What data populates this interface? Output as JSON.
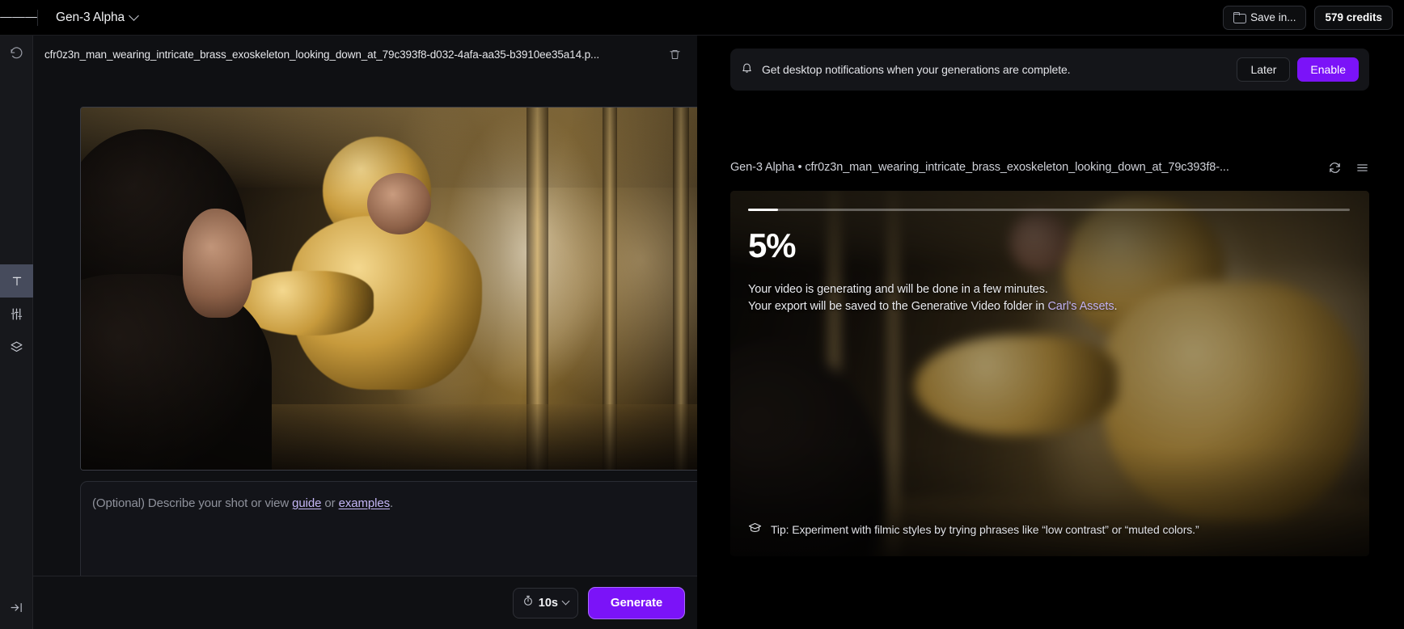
{
  "topbar": {
    "menu_icon": "hamburger-menu-icon",
    "model_name": "Gen-3 Alpha",
    "model_chevron_icon": "chevron-down-icon",
    "save_in_label": "Save in...",
    "save_in_icon": "folder-icon",
    "credits_label": "579 credits"
  },
  "rail": {
    "items": [
      {
        "icon": "history-undo-icon",
        "name": "history"
      },
      {
        "icon": "text-tool-icon",
        "name": "text",
        "label": "T",
        "active": true
      },
      {
        "icon": "sliders-icon",
        "name": "settings"
      },
      {
        "icon": "layers-icon",
        "name": "layers"
      }
    ],
    "expand_icon": "expand-sidebar-icon"
  },
  "left_panel": {
    "filename": "cfr0z3n_man_wearing_intricate_brass_exoskeleton_looking_down_at_79c393f8-d032-4afa-aa35-b3910ee35a14.p...",
    "delete_icon": "trash-icon",
    "image_alt": "man-in-brass-exoskeleton-reference-image",
    "prompt": {
      "value": "",
      "placeholder_prefix": "(Optional) Describe your shot or view ",
      "link_guide": "guide",
      "placeholder_or": " or ",
      "link_examples": "examples",
      "placeholder_suffix": "."
    },
    "duration": {
      "icon": "stopwatch-icon",
      "value": "10s",
      "chevron_icon": "chevron-down-icon"
    },
    "generate_label": "Generate"
  },
  "right_panel": {
    "notification": {
      "icon": "bell-icon",
      "message": "Get desktop notifications when your generations are complete.",
      "later_label": "Later",
      "enable_label": "Enable"
    },
    "job": {
      "title": "Gen-3 Alpha • cfr0z3n_man_wearing_intricate_brass_exoskeleton_looking_down_at_79c393f8-...",
      "refresh_icon": "refresh-icon",
      "menu_icon": "list-menu-icon"
    },
    "generation": {
      "progress_percent": 5,
      "percent_label": "5%",
      "line1": "Your video is generating and will be done in a few minutes.",
      "line2_prefix": "Your export will be saved to the Generative Video folder in ",
      "line2_link": "Carl's Assets",
      "line2_suffix": ".",
      "tip_icon": "graduation-cap-icon",
      "tip_text": "Tip: Experiment with filmic styles by trying phrases like “low contrast” or “muted colors.”"
    }
  },
  "colors": {
    "accent_purple": "#7b13f8",
    "link_purple": "#c4b6f5",
    "panel_bg": "#0f1013",
    "rail_bg": "#17181c",
    "topbar_bg": "#000000"
  }
}
